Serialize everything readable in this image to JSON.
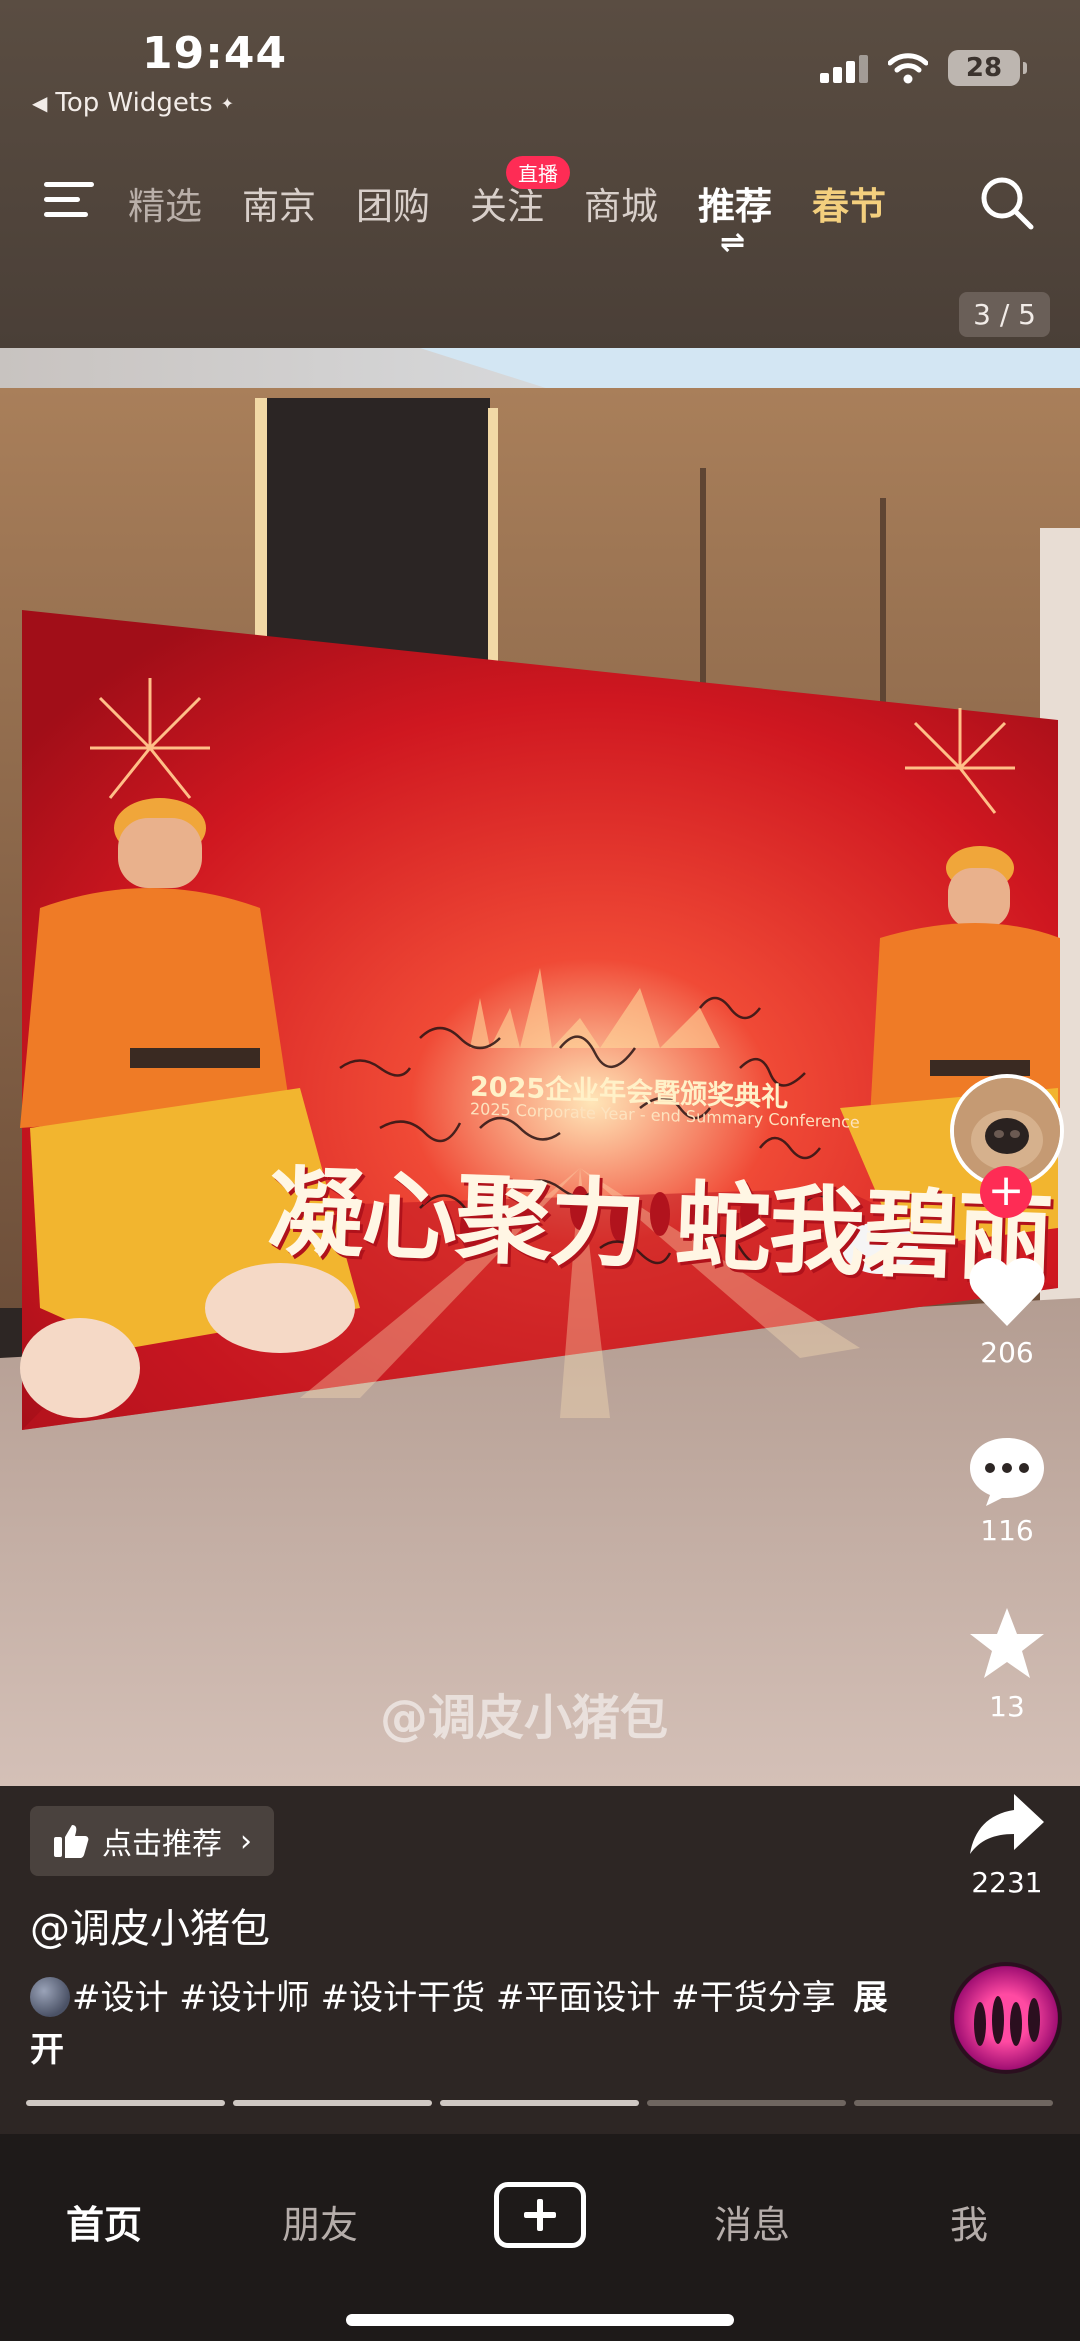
{
  "status_bar": {
    "time": "19:44",
    "back_app": "Top Widgets",
    "battery": "28",
    "signal_icon": "signal-icon",
    "wifi_icon": "wifi-icon"
  },
  "top_nav": {
    "tabs": [
      {
        "label": "精选"
      },
      {
        "label": "南京"
      },
      {
        "label": "团购"
      },
      {
        "label": "关注",
        "badge": "直播"
      },
      {
        "label": "商城"
      },
      {
        "label": "推荐"
      },
      {
        "label": "春节"
      }
    ],
    "active_tab": "推荐",
    "menu_icon": "menu-icon",
    "search_icon": "search-icon"
  },
  "post": {
    "page_counter": "3 / 5",
    "image_text": {
      "title": "2025企业年会暨颁奖典礼",
      "subtitle": "2025 Corporate Year - end Summary Conference",
      "slogan": "凝心聚力 蛇我碧丽"
    },
    "watermark": "@调皮小猪包",
    "author": "@调皮小猪包",
    "description_tags": "#设计 #设计师 #设计干货 #平面设计 #干货分享",
    "expand_label": "展开",
    "recommend_label": "点击推荐",
    "image_index": 3,
    "image_total": 5
  },
  "actions": {
    "likes": "206",
    "comments": "116",
    "favorites": "13",
    "shares": "2231"
  },
  "bottom_nav": {
    "home": "首页",
    "friends": "朋友",
    "messages": "消息",
    "me": "我"
  },
  "colors": {
    "accent": "#fe2c55",
    "festival": "#f3cf7e",
    "background": "#2d2624",
    "banner_red": "#c8141f"
  }
}
